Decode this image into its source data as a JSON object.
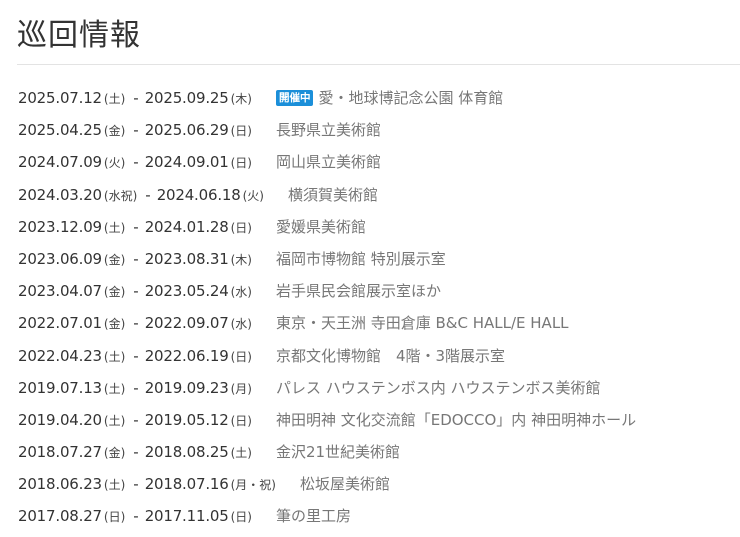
{
  "title": "巡回情報",
  "badge": "開催中",
  "tours": [
    {
      "start": "2025.07.12",
      "start_dow": "(土)",
      "end": "2025.09.25",
      "end_dow": "(木)",
      "venue": "愛・地球博記念公園 体育館",
      "active": true
    },
    {
      "start": "2025.04.25",
      "start_dow": "(金)",
      "end": "2025.06.29",
      "end_dow": "(日)",
      "venue": "長野県立美術館"
    },
    {
      "start": "2024.07.09",
      "start_dow": "(火)",
      "end": "2024.09.01",
      "end_dow": "(日)",
      "venue": "岡山県立美術館"
    },
    {
      "start": "2024.03.20",
      "start_dow": "(水祝)",
      "end": "2024.06.18",
      "end_dow": "(火)",
      "venue": "横須賀美術館"
    },
    {
      "start": "2023.12.09",
      "start_dow": "(土)",
      "end": "2024.01.28",
      "end_dow": "(日)",
      "venue": "愛媛県美術館"
    },
    {
      "start": "2023.06.09",
      "start_dow": "(金)",
      "end": "2023.08.31",
      "end_dow": "(木)",
      "venue": "福岡市博物館 特別展示室"
    },
    {
      "start": "2023.04.07",
      "start_dow": "(金)",
      "end": "2023.05.24",
      "end_dow": "(水)",
      "venue": "岩手県民会館展示室ほか"
    },
    {
      "start": "2022.07.01",
      "start_dow": "(金)",
      "end": "2022.09.07",
      "end_dow": "(水)",
      "venue": "東京・天王洲 寺田倉庫 B&C HALL/E HALL"
    },
    {
      "start": "2022.04.23",
      "start_dow": "(土)",
      "end": "2022.06.19",
      "end_dow": "(日)",
      "venue": "京都文化博物館　4階・3階展示室"
    },
    {
      "start": "2019.07.13",
      "start_dow": "(土)",
      "end": "2019.09.23",
      "end_dow": "(月)",
      "venue": "パレス ハウステンボス内 ハウステンボス美術館"
    },
    {
      "start": "2019.04.20",
      "start_dow": "(土)",
      "end": "2019.05.12",
      "end_dow": "(日)",
      "venue": "神田明神 文化交流館「EDOCCO」内 神田明神ホール"
    },
    {
      "start": "2018.07.27",
      "start_dow": "(金)",
      "end": "2018.08.25",
      "end_dow": "(土)",
      "venue": "金沢21世紀美術館"
    },
    {
      "start": "2018.06.23",
      "start_dow": "(土)",
      "end": "2018.07.16",
      "end_dow": "(月・祝)",
      "venue": "松坂屋美術館"
    },
    {
      "start": "2017.08.27",
      "start_dow": "(日)",
      "end": "2017.11.05",
      "end_dow": "(日)",
      "venue": "筆の里工房"
    }
  ]
}
